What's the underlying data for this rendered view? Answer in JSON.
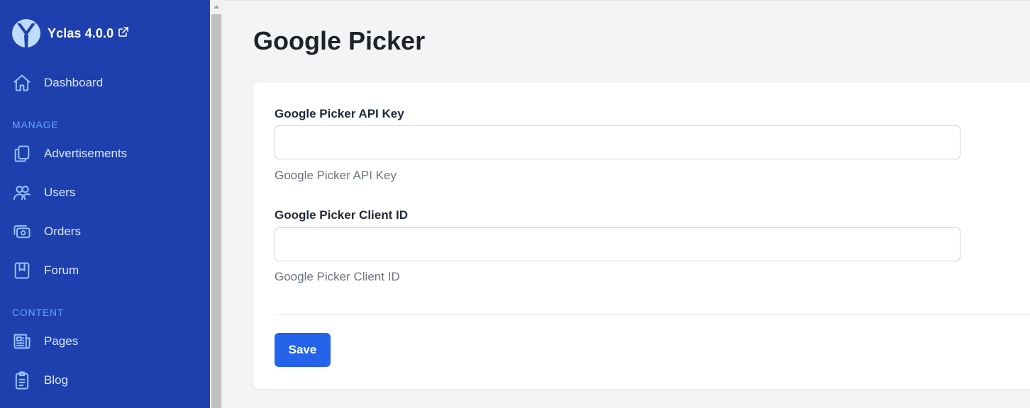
{
  "app": {
    "name": "Yclas 4.0.0",
    "logo_icon": "yclas-logo-icon",
    "external_icon": "external-link-icon"
  },
  "sidebar": {
    "dashboard": {
      "label": "Dashboard",
      "icon": "home-icon"
    },
    "sections": [
      {
        "title": "MANAGE",
        "items": [
          {
            "label": "Advertisements",
            "icon": "copy-icon"
          },
          {
            "label": "Users",
            "icon": "users-icon"
          },
          {
            "label": "Orders",
            "icon": "cash-icon"
          },
          {
            "label": "Forum",
            "icon": "bookmark-icon"
          }
        ]
      },
      {
        "title": "CONTENT",
        "items": [
          {
            "label": "Pages",
            "icon": "newspaper-icon"
          },
          {
            "label": "Blog",
            "icon": "clipboard-icon"
          }
        ]
      }
    ]
  },
  "page": {
    "title": "Google Picker"
  },
  "form": {
    "fields": [
      {
        "label": "Google Picker API Key",
        "value": "",
        "placeholder": "",
        "help": "Google Picker API Key"
      },
      {
        "label": "Google Picker Client ID",
        "value": "",
        "placeholder": "",
        "help": "Google Picker Client ID"
      }
    ],
    "save_label": "Save"
  },
  "colors": {
    "sidebar_bg": "#1e40af",
    "section_title": "#60a5fa",
    "primary_button": "#2563eb",
    "page_bg": "#f3f4f6"
  }
}
